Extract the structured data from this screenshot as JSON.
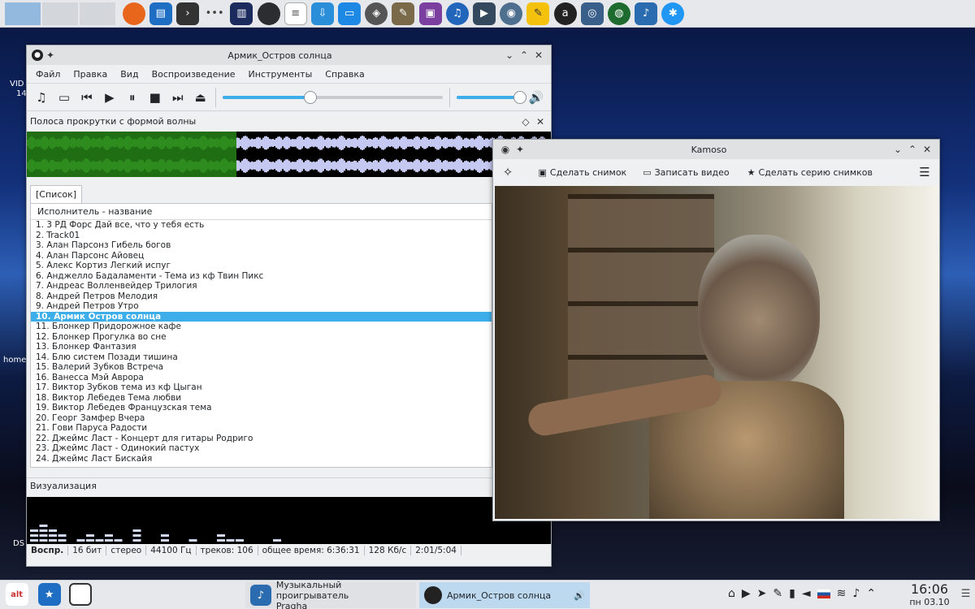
{
  "desktop": {
    "label1": "VID",
    "label2": "14",
    "label3": "home",
    "label4": "DS"
  },
  "player": {
    "title": "Армик_Остров солнца",
    "menu": [
      "Файл",
      "Правка",
      "Вид",
      "Воспроизведение",
      "Инструменты",
      "Справка"
    ],
    "progress_fraction": 0.4,
    "volume_fraction": 0.97,
    "wave_panel_title": "Полоса прокрутки с формой волны",
    "played_fraction": 0.4,
    "tab": "[Список]",
    "column_header": "Исполнитель - название",
    "tracks": [
      "1. 3 РД Форс Дай все, что у тебя есть",
      "2. Track01",
      "3. Алан Парсонз Гибель богов",
      "4. Алан Парсонс Айовец",
      "5. Алекс Кортиз Легкий испуг",
      "6. Анджелло Бадаламенти - Тема из кф Твин Пикс",
      "7. Андреас Волленвейдер Трилогия",
      "8. Андрей Петров Мелодия",
      "9. Андрей Петров Утро",
      "10. Армик Остров солнца",
      "11. Блонкер Придорожное кафе",
      "12. Блонкер Прогулка во сне",
      "13. Блонкер Фантазия",
      "14. Блю систем Позади тишина",
      "15. Валерий Зубков Встреча",
      "16. Ванесса Мэй Аврора",
      "17. Виктор Зубков тема из кф Цыган",
      "18. Виктор Лебедев Тема любви",
      "19. Виктор Лебедев Французская тема",
      "20. Георг Замфер Вчера",
      "21. Гови Паруса Радости",
      "22. Джеймс Ласт - Концерт для гитары Родриго",
      "23. Джеймс Ласт - Одинокий пастух",
      "24. Джеймс Ласт Бискайя"
    ],
    "selected_index": 9,
    "vis_title": "Визуализация",
    "status": [
      "Воспр.",
      "16 бит",
      "стерео",
      "44100 Гц",
      "треков: 106",
      "общее время: 6:36:31",
      "128 Кб/с",
      "2:01/5:04"
    ]
  },
  "kamoso": {
    "title": "Kamoso",
    "snapshot": "Сделать снимок",
    "record": "Записать видео",
    "burst": "Сделать серию снимков"
  },
  "taskbar": {
    "task1_line1": "Музыкальный проигрыватель",
    "task1_line2": "Pragha",
    "task2": "Армик_Остров солнца",
    "time": "16:06",
    "date": "пн 03.10"
  },
  "colors": {
    "accent": "#3daee9",
    "wave_played": "#2e8b1e",
    "wave_rest": "#c5c8f0"
  }
}
